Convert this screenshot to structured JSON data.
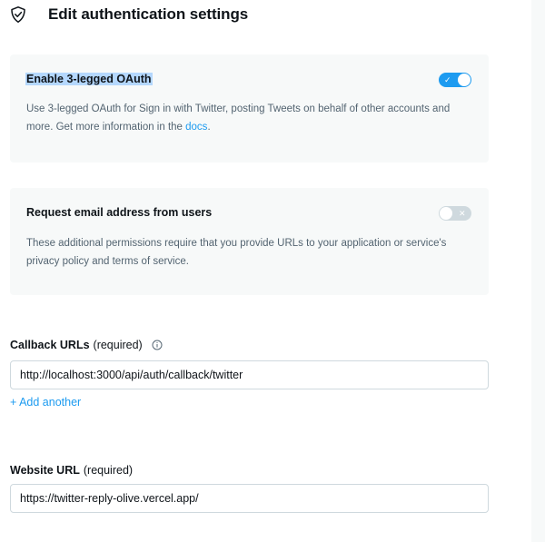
{
  "header": {
    "title": "Edit authentication settings",
    "icon": "shield-check-icon"
  },
  "oauth": {
    "title": "Enable 3-legged OAuth",
    "description_pre": "Use 3-legged OAuth for Sign in with Twitter, posting Tweets on behalf of other accounts and more. Get more information in the ",
    "docs_link": "docs",
    "description_post": ".",
    "toggle_state": "on",
    "toggle_mark": "✓"
  },
  "email": {
    "title": "Request email address from users",
    "description": "These additional permissions require that you provide URLs to your application or service's privacy policy and terms of service.",
    "toggle_state": "off",
    "toggle_mark": "✕"
  },
  "callback": {
    "label": "Callback URLs",
    "required": "(required)",
    "value": "http://localhost:3000/api/auth/callback/twitter",
    "add_another": "+ Add another"
  },
  "website": {
    "label": "Website URL",
    "required": "(required)",
    "value": "https://twitter-reply-olive.vercel.app/"
  },
  "colors": {
    "accent": "#1d9bf0",
    "card_bg": "#f7f9f9",
    "selection": "#b4d7fd",
    "muted_text": "#536471",
    "border": "#cfd9de"
  }
}
